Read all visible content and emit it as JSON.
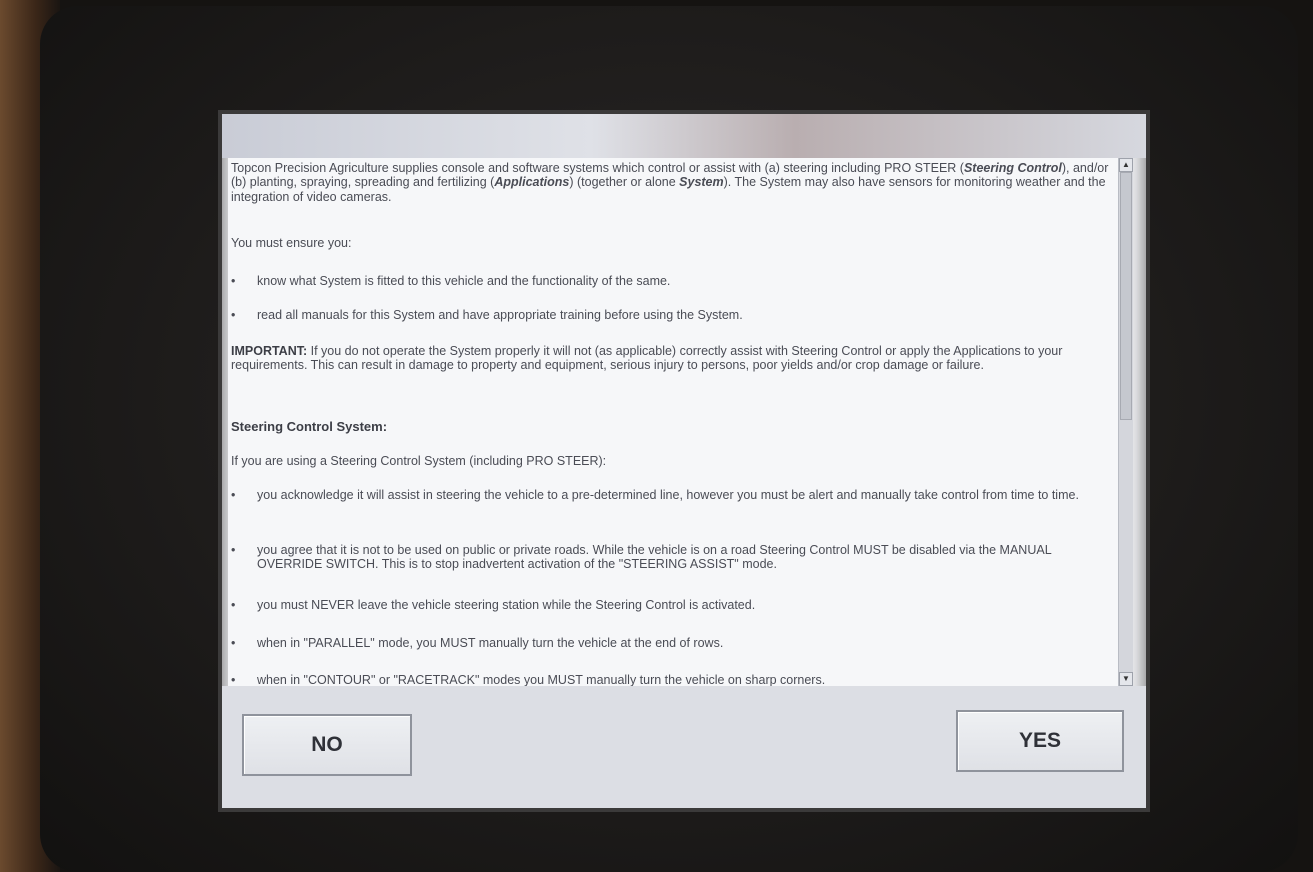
{
  "paragraphs": {
    "intro_1": "Topcon Precision Agriculture supplies console and software systems which control or assist with (a) steering including PRO STEER (",
    "intro_steering": "Steering Control",
    "intro_2": "), and/or (b) planting, spraying, spreading and fertilizing (",
    "intro_apps": "Applications",
    "intro_3": ") (together or alone ",
    "intro_system": "System",
    "intro_4": ").  The System may also have sensors for monitoring weather and the integration of video cameras.",
    "ensure": "You must ensure you:",
    "important_label": "IMPORTANT:",
    "important_text": " If you do not operate the System properly it will not (as applicable) correctly assist with Steering Control or apply the Applications to your requirements.  This can result in damage to property and equipment, serious injury to persons, poor yields and/or crop damage or failure.",
    "steering_heading": "Steering Control System:",
    "steering_intro": "If you are using a Steering Control System (including PRO STEER):"
  },
  "bullets_ensure": [
    "know what System is fitted to this vehicle and the functionality of the same.",
    "read all manuals for this System and have appropriate training before using the System."
  ],
  "bullets_steering": [
    "you acknowledge it will assist in steering the vehicle to a pre-determined line, however you must be alert and manually take control from time to time.",
    "you agree that it is not to be used on public or private roads.  While the vehicle is on a road Steering Control MUST be disabled via the MANUAL OVERRIDE SWITCH.  This is to stop inadvertent activation of the \"STEERING ASSIST\" mode.",
    "you must NEVER leave the vehicle steering station while the Steering Control is activated.",
    "when in \"PARALLEL\" mode, you MUST manually turn the vehicle at the end of rows.",
    "when in \"CONTOUR\" or \"RACETRACK\" modes you MUST manually turn the vehicle on sharp corners."
  ],
  "bullet_symbol": "•",
  "scroll": {
    "up": "▲",
    "down": "▼"
  },
  "buttons": {
    "no": "NO",
    "yes": "YES"
  }
}
